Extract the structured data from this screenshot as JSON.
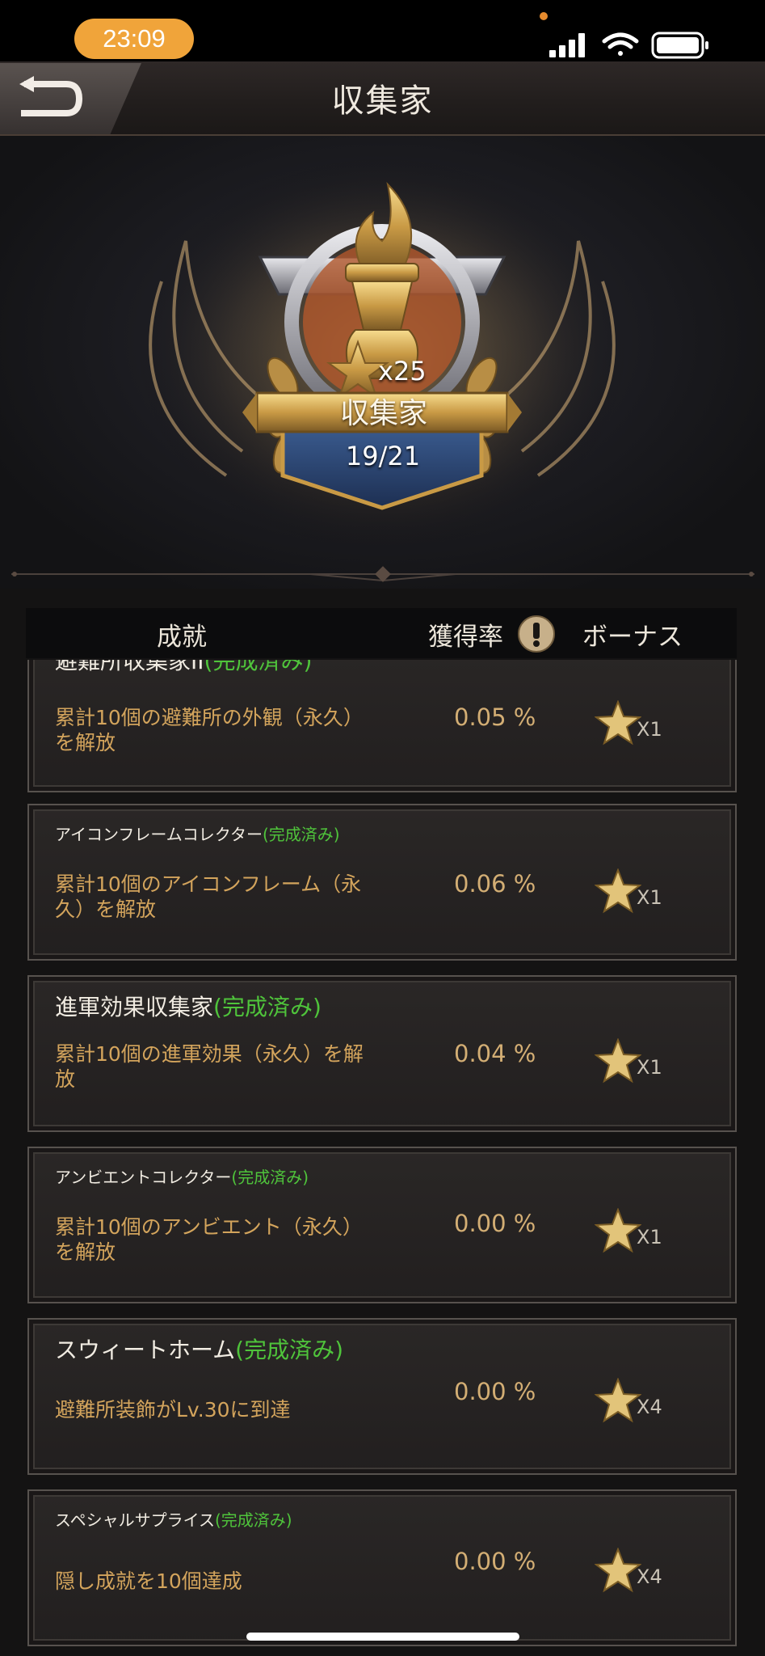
{
  "status_bar": {
    "time": "23:09"
  },
  "header": {
    "title": "収集家"
  },
  "emblem": {
    "star_count": "x25",
    "title": "収集家",
    "progress": "19/21"
  },
  "columns": {
    "achievement": "成就",
    "rate": "獲得率",
    "bonus": "ボーナス"
  },
  "achievements": [
    {
      "name": "避難所収集家II",
      "status": "(完成済み)",
      "description": "累計10個の避難所の外観（永久）を解放",
      "desc_lines": [
        "累計10個の避難所の外観（永久）",
        "を解放"
      ],
      "rate": "0.05 %",
      "bonus": "X1"
    },
    {
      "name": "アイコンフレームコレクター",
      "status": "(完成済み)",
      "description": "累計10個のアイコンフレーム（永久）を解放",
      "desc_lines": [
        "累計10個のアイコンフレーム（永",
        "久）を解放"
      ],
      "rate": "0.06 %",
      "bonus": "X1"
    },
    {
      "name": "進軍効果収集家",
      "status": "(完成済み)",
      "description": "累計10個の進軍効果（永久）を解放",
      "desc_lines": [
        "累計10個の進軍効果（永久）を解",
        "放"
      ],
      "rate": "0.04 %",
      "bonus": "X1"
    },
    {
      "name": "アンビエントコレクター",
      "status": "(完成済み)",
      "description": "累計10個のアンビエント（永久）を解放",
      "desc_lines": [
        "累計10個のアンビエント（永久）",
        "を解放"
      ],
      "rate": "0.00 %",
      "bonus": "X1"
    },
    {
      "name": "スウィートホーム",
      "status": "(完成済み)",
      "description": "避難所装飾がLv.30に到達",
      "desc_lines": [
        "避難所装飾がLv.30に到達"
      ],
      "rate": "0.00 %",
      "bonus": "X4"
    },
    {
      "name": "スペシャルサプライス",
      "status": "(完成済み)",
      "description": "隠し成就を10個達成",
      "desc_lines": [
        "隠し成就を10個達成"
      ],
      "rate": "0.00 %",
      "bonus": "X4"
    }
  ]
}
